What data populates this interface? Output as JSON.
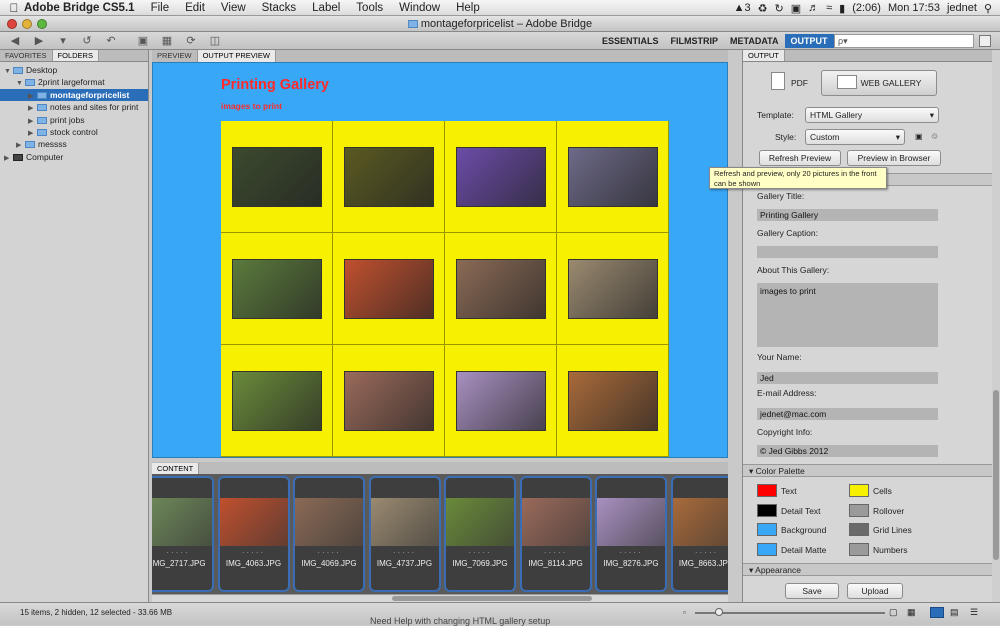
{
  "menubar": {
    "app": "Adobe Bridge CS5.1",
    "items": [
      "File",
      "Edit",
      "View",
      "Stacks",
      "Label",
      "Tools",
      "Window",
      "Help"
    ],
    "battery": "(2:06)",
    "clock": "Mon 17:53",
    "user": "jednet",
    "badge": "3"
  },
  "window": {
    "title": "montageforpricelist – Adobe Bridge"
  },
  "toolbar": {
    "workspaces": [
      "ESSENTIALS",
      "FILMSTRIP",
      "METADATA",
      "OUTPUT"
    ],
    "active_workspace": "OUTPUT",
    "search_placeholder": "ρ▾"
  },
  "left": {
    "tabs": [
      "FAVORITES",
      "FOLDERS"
    ],
    "tree": [
      {
        "label": "Desktop",
        "depth": 0,
        "open": true,
        "selected": false
      },
      {
        "label": "2print largeformat",
        "depth": 1,
        "open": true,
        "selected": false
      },
      {
        "label": "montageforpricelist",
        "depth": 2,
        "open": false,
        "selected": true
      },
      {
        "label": "notes and sites for print",
        "depth": 2,
        "open": false,
        "selected": false
      },
      {
        "label": "print jobs",
        "depth": 2,
        "open": false,
        "selected": false
      },
      {
        "label": "stock control",
        "depth": 2,
        "open": false,
        "selected": false
      },
      {
        "label": "messss",
        "depth": 1,
        "open": false,
        "selected": false
      },
      {
        "label": "Computer",
        "depth": 0,
        "open": false,
        "selected": false
      }
    ]
  },
  "center": {
    "tabs": [
      "PREVIEW",
      "OUTPUT PREVIEW"
    ],
    "active_tab": "OUTPUT PREVIEW",
    "gallery_title": "Printing Gallery",
    "gallery_caption": "images to print",
    "content_tab": "CONTENT",
    "thumb_colors": [
      "#3b4a2e",
      "#5a5a22",
      "#6b4ca8",
      "#6d6a88",
      "#5b7a3c",
      "#c0502e",
      "#8a6a55",
      "#9a8a70",
      "#6a8a3a",
      "#9a6a5a",
      "#a890c0",
      "#a86a3a"
    ],
    "filmstrip": [
      {
        "name": "IMG_2717.JPG",
        "color": "#6f8a5a"
      },
      {
        "name": "IMG_4063.JPG",
        "color": "#c0502e"
      },
      {
        "name": "IMG_4069.JPG",
        "color": "#8a6a55"
      },
      {
        "name": "IMG_4737.JPG",
        "color": "#9a8a70"
      },
      {
        "name": "IMG_7069.JPG",
        "color": "#6a8a3a"
      },
      {
        "name": "IMG_8114.JPG",
        "color": "#9a6a5a"
      },
      {
        "name": "IMG_8276.JPG",
        "color": "#a890c0"
      },
      {
        "name": "IMG_8663.JPG",
        "color": "#a86a3a"
      }
    ]
  },
  "status": {
    "text": "15 items, 2 hidden, 12 selected - 33.66 MB",
    "bottom_text": "Need Help with changing HTML gallery setup"
  },
  "output": {
    "panel_title": "OUTPUT",
    "pdf_label": "PDF",
    "web_gallery_label": "WEB GALLERY",
    "template_label": "Template:",
    "template_value": "HTML Gallery",
    "style_label": "Style:",
    "style_value": "Custom",
    "refresh_label": "Refresh Preview",
    "preview_browser_label": "Preview in Browser",
    "tooltip": "Refresh and preview, only 20 pictures in the front can be shown",
    "fields": [
      {
        "label": "Gallery Title:",
        "value": "Printing Gallery"
      },
      {
        "label": "Gallery Caption:",
        "value": ""
      },
      {
        "label": "About This Gallery:",
        "value": "images to print"
      },
      {
        "label": "Your Name:",
        "value": "Jed"
      },
      {
        "label": "E-mail Address:",
        "value": "jednet@mac.com"
      },
      {
        "label": "Copyright Info:",
        "value": "© Jed Gibbs 2012"
      }
    ],
    "color_palette_label": "Color Palette",
    "colors": [
      {
        "label": "Text",
        "color": "#ff0000"
      },
      {
        "label": "Cells",
        "color": "#f7f100"
      },
      {
        "label": "Detail Text",
        "color": "#000000"
      },
      {
        "label": "Rollover",
        "color": "#9a9a9a"
      },
      {
        "label": "Background",
        "color": "#38a8f6"
      },
      {
        "label": "Grid Lines",
        "color": "#6a6a6a"
      },
      {
        "label": "Detail Matte",
        "color": "#38a8f6"
      },
      {
        "label": "Numbers",
        "color": "#9a9a9a"
      }
    ],
    "appearance_label": "Appearance",
    "save_label": "Save",
    "upload_label": "Upload"
  }
}
